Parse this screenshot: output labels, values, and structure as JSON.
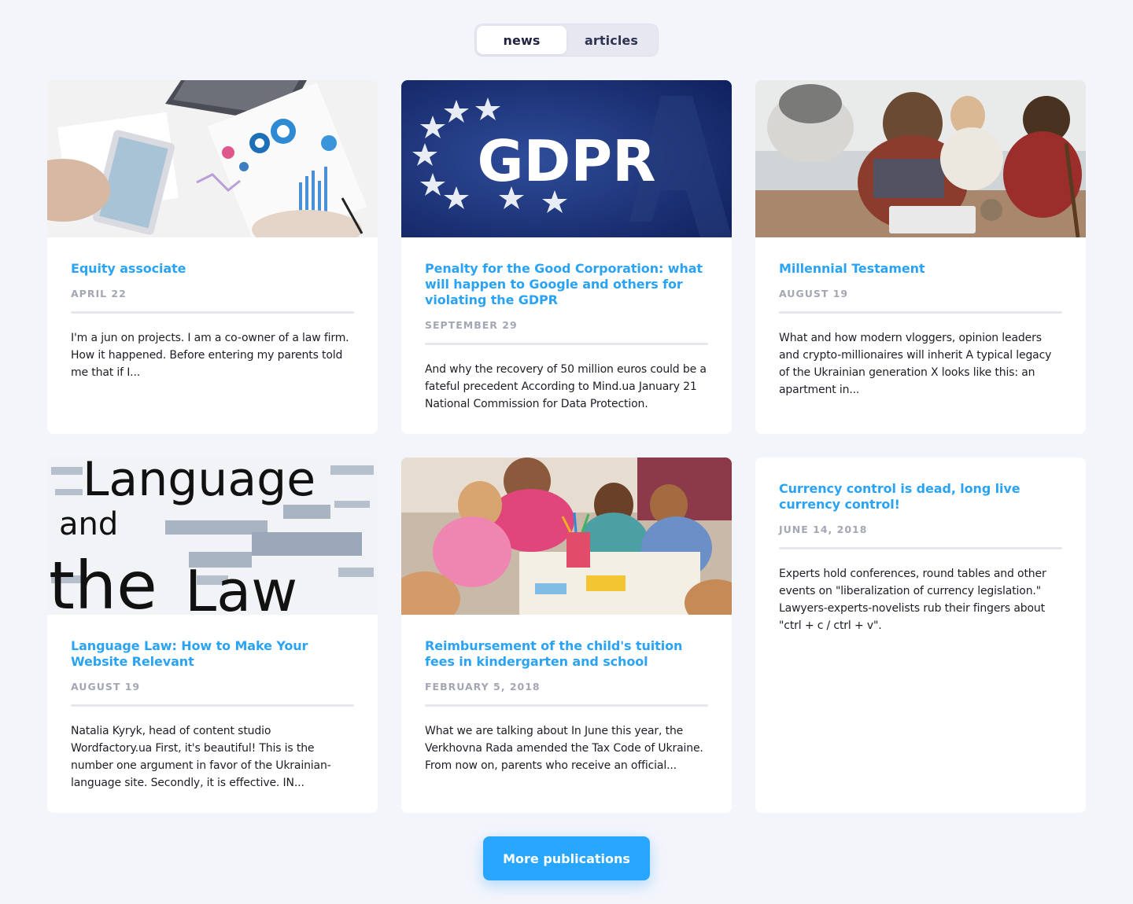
{
  "tabs": [
    {
      "label": "news",
      "active": true
    },
    {
      "label": "articles",
      "active": false
    }
  ],
  "cards": [
    {
      "title": "Equity associate",
      "date": "APRIL 22",
      "excerpt": "I'm a jun on projects. I am a co-owner of a law firm. How it happened. Before entering my parents told me that if I...",
      "image": "business-charts-tablet-photo"
    },
    {
      "title": "Penalty for the Good Corporation: what will happen to Google and others for violating the GDPR",
      "date": "SEPTEMBER 29",
      "excerpt": "And why the recovery of 50 million euros could be a fateful precedent According to Mind.ua January 21 National Commission for Data Protection.",
      "image": "gdpr-banner",
      "image_text": "GDPR"
    },
    {
      "title": "Millennial Testament",
      "date": "AUGUST 19",
      "excerpt": "What and how modern vloggers, opinion leaders and crypto-millionaires will inherit A typical legacy of the Ukrainian generation X looks like this: an apartment in...",
      "image": "young-people-laptop-photo"
    },
    {
      "title": "Language Law: How to Make Your Website Relevant",
      "date": "AUGUST 19",
      "excerpt": "Natalia Kyryk, head of content studio Wordfactory.ua First, it's beautiful! This is the number one argument in favor of the Ukrainian-language site. Secondly, it is effective. IN...",
      "image": "language-and-the-law-word-cloud",
      "image_text": {
        "line1": "Language",
        "line2": "and",
        "line3": "the",
        "line4": "Law"
      }
    },
    {
      "title": "Reimbursement of the child's tuition fees in kindergarten and school",
      "date": "FEBRUARY 5, 2018",
      "excerpt": "What we are talking about In June this year, the Verkhovna Rada amended the Tax Code of Ukraine. From now on, parents who receive an official...",
      "image": "children-classroom-photo"
    },
    {
      "title": "Currency control is dead, long live currency control!",
      "date": "JUNE 14, 2018",
      "excerpt": "Experts hold conferences, round tables and other events on \"liberalization of currency legislation.\" Lawyers-experts-novelists rub their fingers about \"ctrl + c / ctrl + v\".",
      "image": null
    }
  ],
  "more_button": {
    "label": "More publications"
  },
  "colors": {
    "accent": "#29a6ff",
    "title": "#2ba3f5",
    "background": "#f4f5fb",
    "date": "#a4a7b3"
  }
}
